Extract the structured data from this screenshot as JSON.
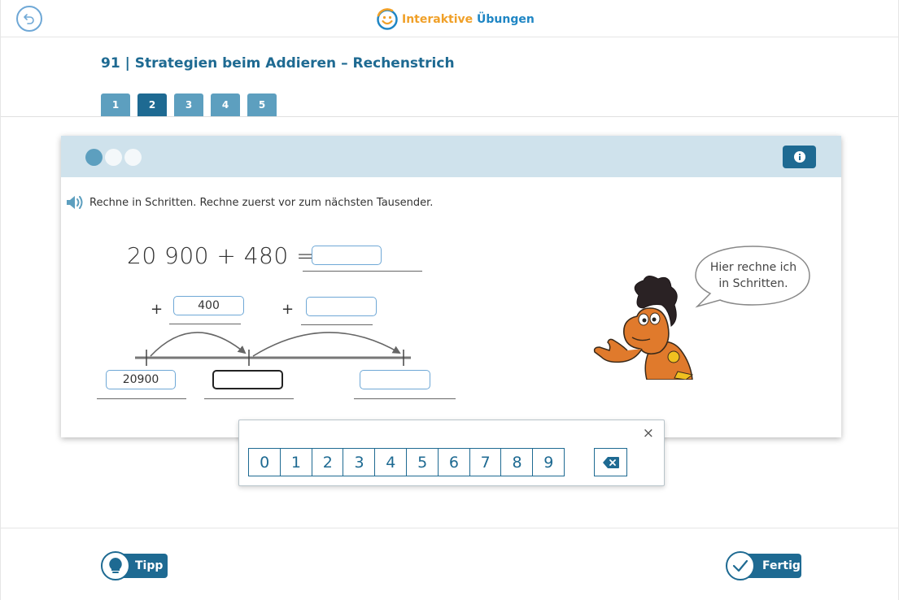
{
  "header": {
    "logo_part1": "Interaktive",
    "logo_part2": "Übungen",
    "back_icon": "back-arrow-icon"
  },
  "exercise": {
    "title": "91 | Strategien beim Addieren – Rechenstrich",
    "tabs": [
      {
        "label": "1",
        "active": false
      },
      {
        "label": "2",
        "active": true
      },
      {
        "label": "3",
        "active": false
      },
      {
        "label": "4",
        "active": false
      },
      {
        "label": "5",
        "active": false
      }
    ]
  },
  "card": {
    "progress_dots": 3,
    "progress_current": 1,
    "instruction": "Rechne in Schritten. Rechne zuerst vor zum nächsten Tausender.",
    "equation": "20 900 + 480 =",
    "result_value": "",
    "step1_operator": "+",
    "step1_value": "400",
    "step2_operator": "+",
    "step2_value": "",
    "numberline_start": "20900",
    "numberline_mid": "",
    "numberline_end": "",
    "speech": "Hier rechne ich in Schritten."
  },
  "numpad": {
    "keys": [
      "0",
      "1",
      "2",
      "3",
      "4",
      "5",
      "6",
      "7",
      "8",
      "9"
    ],
    "close_label": "×",
    "backspace_icon": "backspace-icon"
  },
  "footer": {
    "tip_label": "Tipp",
    "done_label": "Fertig"
  },
  "colors": {
    "primary": "#1e6a92",
    "tab": "#5d9fbf",
    "card_header": "#cfe2ec",
    "input_border": "#6fa8d6"
  }
}
